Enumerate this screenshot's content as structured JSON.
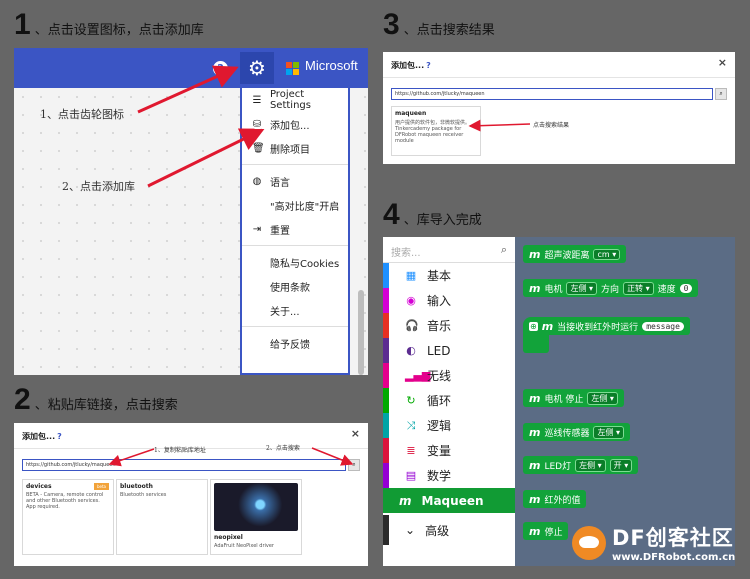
{
  "steps": {
    "s1": {
      "num": "1",
      "text": "、点击设置图标，点击添加库"
    },
    "s2": {
      "num": "2",
      "text": "、粘贴库链接，点击搜索"
    },
    "s3": {
      "num": "3",
      "text": "、点击搜索结果"
    },
    "s4": {
      "num": "4",
      "text": "、库导入完成"
    }
  },
  "panel1": {
    "help_icon": "?",
    "gear_icon": "⚙",
    "brand": "Microsoft",
    "annotation_gear": "1、点击齿轮图标",
    "annotation_add": "2、点击添加库",
    "menu": [
      {
        "icon": "☰",
        "label": "Project Settings"
      },
      {
        "icon": "⛁",
        "label": "添加包..."
      },
      {
        "icon": "🗑",
        "label": "删除项目"
      },
      {
        "sep": true
      },
      {
        "icon": "◍",
        "label": "语言"
      },
      {
        "icon": "",
        "label": "\"高对比度\"开启"
      },
      {
        "icon": "⇥",
        "label": "重置"
      },
      {
        "sep": true
      },
      {
        "icon": "",
        "label": "隐私与Cookies"
      },
      {
        "icon": "",
        "label": "使用条款"
      },
      {
        "icon": "",
        "label": "关于..."
      },
      {
        "sep": true
      },
      {
        "icon": "",
        "label": "给予反馈"
      }
    ]
  },
  "panel2": {
    "title": "添加包...",
    "help": "?",
    "close": "×",
    "search_value": "https://github.com/jtlucky/maqueen",
    "search_icon": "⌕",
    "annotation_paste": "1、复制粘贴库地址",
    "annotation_search": "2、点击搜索",
    "cards": [
      {
        "title": "devices",
        "badge": "beta",
        "desc": "BETA - Camera, remote control and other Bluetooth services. App required."
      },
      {
        "title": "bluetooth",
        "desc": "Bluetooth services"
      },
      {
        "title": "neopixel",
        "desc": "AdaFruit NeoPixel driver"
      }
    ]
  },
  "panel3": {
    "title": "添加包...",
    "help": "?",
    "close": "×",
    "search_value": "https://github.com/jtlucky/maqueen",
    "search_icon": "⌕",
    "result": {
      "title": "maqueen",
      "desc": "用户提供的软件包，非微软提供。Tinkercademy package for DFRobot maqueen receiver module"
    },
    "annotation_result": "点击搜索结果"
  },
  "panel4": {
    "search_placeholder": "搜索...",
    "search_icon": "⌕",
    "categories": [
      {
        "icon": "▦",
        "label": "基本",
        "color": "#1e90ff"
      },
      {
        "icon": "◉",
        "label": "输入",
        "color": "#d400d4"
      },
      {
        "icon": "🎧",
        "label": "音乐",
        "color": "#e63022"
      },
      {
        "icon": "◐",
        "label": "LED",
        "color": "#5c2d91"
      },
      {
        "icon": "▂▄▆",
        "label": "无线",
        "color": "#e3008c"
      },
      {
        "icon": "↻",
        "label": "循环",
        "color": "#00aa00"
      },
      {
        "icon": "⤨",
        "label": "逻辑",
        "color": "#00a4a6"
      },
      {
        "icon": "≣",
        "label": "变量",
        "color": "#dc143c"
      },
      {
        "icon": "▤",
        "label": "数学",
        "color": "#9400d3"
      }
    ],
    "maqueen": {
      "icon": "m",
      "label": "Maqueen"
    },
    "advanced": {
      "icon": "⌄",
      "label": "高级"
    },
    "blocks": {
      "b1": {
        "m": "m",
        "label": "超声波距离",
        "dd": "cm ▾"
      },
      "b2": {
        "m": "m",
        "label": "电机",
        "dd1": "左侧 ▾",
        "label2": "方向",
        "dd2": "正转 ▾",
        "label3": "速度",
        "val": "0"
      },
      "b3": {
        "icon": "⊕",
        "m": "m",
        "label": "当接收到红外时运行",
        "field": "message"
      },
      "b4": {
        "m": "m",
        "label": "电机 停止",
        "dd": "左侧 ▾"
      },
      "b5": {
        "m": "m",
        "label": "巡线传感器",
        "dd": "左侧 ▾"
      },
      "b6": {
        "m": "m",
        "label": "LED灯",
        "dd1": "左侧 ▾",
        "dd2": "开 ▾"
      },
      "b7": {
        "m": "m",
        "label": "红外的值"
      },
      "b8": {
        "m": "m",
        "label": "停止"
      }
    }
  },
  "watermark": {
    "text": "DF创客社区",
    "url": "www.DFRobot.com.cn"
  },
  "colors": {
    "accent_blue": "#3b55c4",
    "annotation_red": "#e0182f",
    "maqueen_green": "#12a33a"
  }
}
